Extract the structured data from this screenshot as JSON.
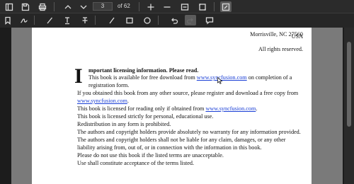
{
  "toolbar": {
    "page_number": "3",
    "page_count": "of 62"
  },
  "document": {
    "address_line": "Morrisville, NC 27560",
    "country": "USA",
    "rights": "All rights reserved.",
    "dropcap": "I",
    "heading": "mportant licensing information. Please read.",
    "line1_pre": "This book is available for free download from ",
    "line1_link": "www.syncfusion.com",
    "line1_post": " on completion of a",
    "line2": "registration form.",
    "line3": "If you obtained this book from any other source, please register and download a free copy from",
    "line4_link": "www.syncfusion.com",
    "line4_post": ".",
    "line5_pre": "This book is licensed for reading only if obtained from ",
    "line5_link": "www.syncfusion.com",
    "line5_post": ".",
    "line6": "This book is licensed strictly for personal, educational use.",
    "line7": "Redistribution in any form is prohibited.",
    "line8": "The authors and copyright holders provide absolutely no warranty for any information provided.",
    "line9": "The authors and copyright holders shall not be liable for any claim, damages, or any other",
    "line10": "liability arising from, out of, or in connection with the information in this book.",
    "line11": "Please do not use this book if the listed terms are unacceptable.",
    "line12": "Use shall constitute acceptance of the terms listed."
  }
}
